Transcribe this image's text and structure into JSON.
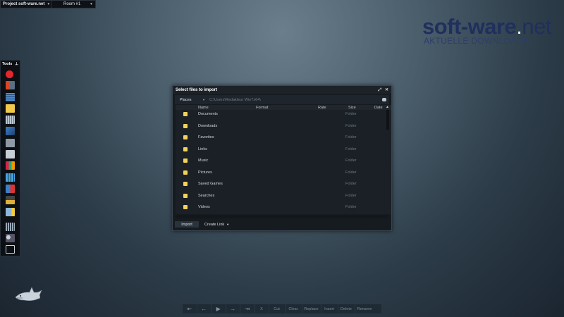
{
  "topbar": {
    "project": "Project soft-ware.net",
    "room": "Room #1"
  },
  "watermark": {
    "brand_a": "soft-ware",
    "brand_dot": ".",
    "brand_b": "net",
    "sub": "AKTUELLE DOWNLOADS"
  },
  "tools": {
    "title": "Tools",
    "pin": "⊥"
  },
  "dialog": {
    "title": "Select files to import",
    "title_buttons": [
      "⤢",
      "✕"
    ],
    "places": "Places",
    "path": "C:\\Users\\Redakteur Win7x64\\",
    "columns": {
      "name": "Name",
      "format": "Format",
      "rate": "Rate",
      "size": "Size",
      "date": "Date"
    },
    "rows": [
      {
        "name": "Documents",
        "type": "Folder"
      },
      {
        "name": "Downloads",
        "type": "Folder"
      },
      {
        "name": "Favorites",
        "type": "Folder"
      },
      {
        "name": "Links",
        "type": "Folder"
      },
      {
        "name": "Music",
        "type": "Folder"
      },
      {
        "name": "Pictures",
        "type": "Folder"
      },
      {
        "name": "Saved Games",
        "type": "Folder"
      },
      {
        "name": "Searches",
        "type": "Folder"
      },
      {
        "name": "Videos",
        "type": "Folder"
      }
    ],
    "import": "Import",
    "create_link": "Create Link"
  },
  "bottombar": {
    "nav": [
      "⇤",
      "←",
      "▶",
      "→",
      "⇥"
    ],
    "actions": [
      "X",
      "Cut",
      "Clear",
      "Replace",
      "Insert",
      "Delete",
      "Rename"
    ]
  }
}
